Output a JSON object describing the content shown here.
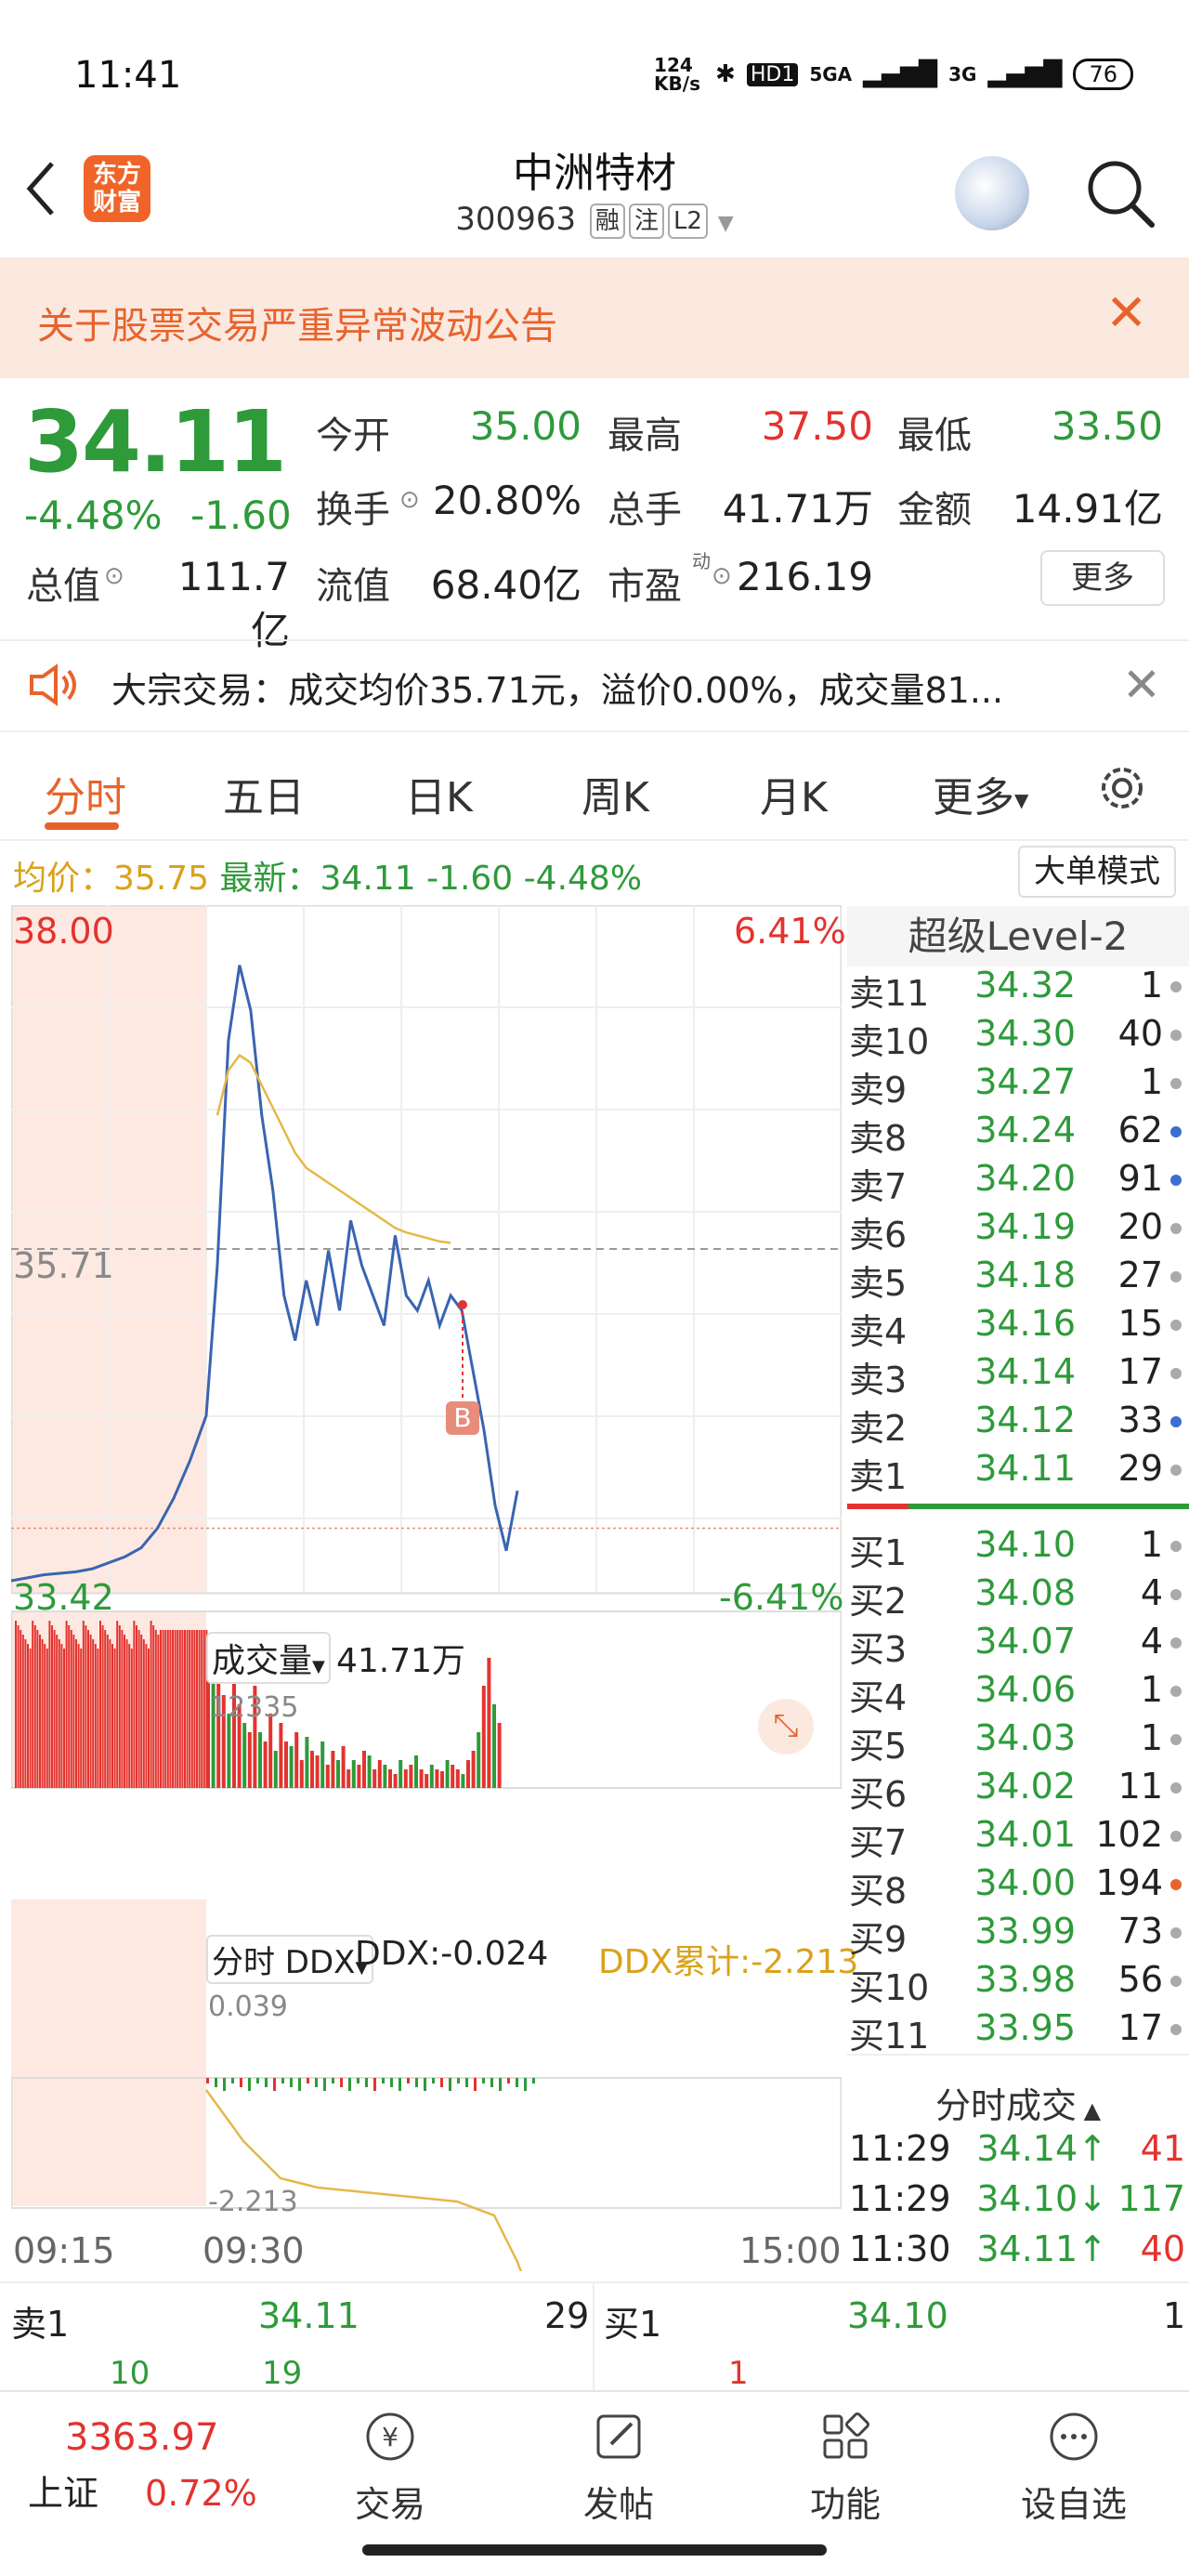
{
  "status": {
    "time": "11:41",
    "net_speed": "124 KB/s",
    "hd": "HD1",
    "sig1": "5GA",
    "sig2": "3G",
    "battery": "76"
  },
  "header": {
    "logo_text": "东方\n财富",
    "name": "中洲特材",
    "code": "300963",
    "tags": [
      "融",
      "注",
      "L2"
    ]
  },
  "notice": {
    "text": "关于股票交易严重异常波动公告"
  },
  "quote": {
    "price": "34.11",
    "change_pct": "-4.48%",
    "change_amt": "-1.60",
    "open_label": "今开",
    "open": "35.00",
    "high_label": "最高",
    "high": "37.50",
    "low_label": "最低",
    "low": "33.50",
    "turnover_label": "换手",
    "turnover": "20.80%",
    "volume_label": "总手",
    "volume": "41.71万",
    "amount_label": "金额",
    "amount": "14.91亿",
    "mcap_label": "总值",
    "mcap": "111.7亿",
    "float_label": "流值",
    "float": "68.40亿",
    "pe_label": "市盈",
    "pe_sup": "动",
    "pe": "216.19",
    "more": "更多"
  },
  "block_trade": {
    "text": "大宗交易：成交均价35.71元，溢价0.00%，成交量81..."
  },
  "tabs": [
    "分时",
    "五日",
    "日K",
    "周K",
    "月K",
    "更多"
  ],
  "avg_row": {
    "avg_label": "均价：",
    "avg": "35.75",
    "latest_label": "最新：",
    "latest": "34.11",
    "chg": "-1.60",
    "pct": "-4.48%"
  },
  "mode_button": "大单模式",
  "chart_data": {
    "type": "line",
    "title": "",
    "y_top": "38.00",
    "y_bottom": "33.42",
    "pct_top": "6.41%",
    "pct_bottom": "-6.41%",
    "ref_line": "35.71",
    "ylim": [
      33.42,
      38.0
    ],
    "x_ticks": [
      "09:15",
      "09:30",
      "15:00"
    ],
    "price_series": [
      33.5,
      33.52,
      33.54,
      33.55,
      33.56,
      33.58,
      33.62,
      33.66,
      33.72,
      33.85,
      34.05,
      34.3,
      34.6,
      35.6,
      37.1,
      37.6,
      37.3,
      36.6,
      36.1,
      35.4,
      35.1,
      35.5,
      35.2,
      35.7,
      35.3,
      35.9,
      35.6,
      35.4,
      35.2,
      35.8,
      35.4,
      35.3,
      35.5,
      35.2,
      35.4,
      35.3,
      34.9,
      34.5,
      34.0,
      33.7,
      34.1
    ],
    "avg_series": [
      null,
      null,
      null,
      null,
      null,
      null,
      null,
      null,
      null,
      null,
      null,
      null,
      null,
      36.6,
      36.9,
      37.0,
      36.95,
      36.8,
      36.65,
      36.5,
      36.35,
      36.25,
      36.2,
      36.15,
      36.1,
      36.05,
      36.0,
      35.95,
      35.9,
      35.85,
      35.82,
      35.8,
      35.78,
      35.76,
      35.75
    ],
    "volume": {
      "label": "成交量",
      "total": "41.71万",
      "max_label": "12335"
    },
    "ddx": {
      "label": "分时 DDX",
      "value_label": "DDX:",
      "value": "-0.024",
      "cum_label": "DDX累计:",
      "cum": "-2.213",
      "top": "0.039",
      "bottom": "-2.213"
    },
    "marker": "B"
  },
  "orderbook": {
    "title": "超级Level-2",
    "asks": [
      {
        "label": "卖11",
        "price": "34.32",
        "vol": "1",
        "dot": "#aaaaaa"
      },
      {
        "label": "卖10",
        "price": "34.30",
        "vol": "40",
        "dot": "#aaaaaa"
      },
      {
        "label": "卖9",
        "price": "34.27",
        "vol": "1",
        "dot": "#aaaaaa"
      },
      {
        "label": "卖8",
        "price": "34.24",
        "vol": "62",
        "dot": "#3a6fd0"
      },
      {
        "label": "卖7",
        "price": "34.20",
        "vol": "91",
        "dot": "#3a6fd0"
      },
      {
        "label": "卖6",
        "price": "34.19",
        "vol": "20",
        "dot": "#aaaaaa"
      },
      {
        "label": "卖5",
        "price": "34.18",
        "vol": "27",
        "dot": "#aaaaaa"
      },
      {
        "label": "卖4",
        "price": "34.16",
        "vol": "15",
        "dot": "#aaaaaa"
      },
      {
        "label": "卖3",
        "price": "34.14",
        "vol": "17",
        "dot": "#aaaaaa"
      },
      {
        "label": "卖2",
        "price": "34.12",
        "vol": "33",
        "dot": "#3a6fd0"
      },
      {
        "label": "卖1",
        "price": "34.11",
        "vol": "29",
        "dot": "#aaaaaa"
      }
    ],
    "bids": [
      {
        "label": "买1",
        "price": "34.10",
        "vol": "1",
        "dot": "#aaaaaa"
      },
      {
        "label": "买2",
        "price": "34.08",
        "vol": "4",
        "dot": "#aaaaaa"
      },
      {
        "label": "买3",
        "price": "34.07",
        "vol": "4",
        "dot": "#aaaaaa"
      },
      {
        "label": "买4",
        "price": "34.06",
        "vol": "1",
        "dot": "#aaaaaa"
      },
      {
        "label": "买5",
        "price": "34.03",
        "vol": "1",
        "dot": "#aaaaaa"
      },
      {
        "label": "买6",
        "price": "34.02",
        "vol": "11",
        "dot": "#aaaaaa"
      },
      {
        "label": "买7",
        "price": "34.01",
        "vol": "102",
        "dot": "#aaaaaa"
      },
      {
        "label": "买8",
        "price": "34.00",
        "vol": "194",
        "dot": "#e8632c"
      },
      {
        "label": "买9",
        "price": "33.99",
        "vol": "73",
        "dot": "#aaaaaa"
      },
      {
        "label": "买10",
        "price": "33.98",
        "vol": "56",
        "dot": "#aaaaaa"
      },
      {
        "label": "买11",
        "price": "33.95",
        "vol": "17",
        "dot": "#aaaaaa"
      }
    ],
    "ticks_title": "分时成交",
    "ticks": [
      {
        "time": "11:29",
        "price": "34.14",
        "dir": "↑",
        "vol": "41",
        "color": "#2e9a3a",
        "vcolor": "#e3332f"
      },
      {
        "time": "11:29",
        "price": "34.10",
        "dir": "↓",
        "vol": "117",
        "color": "#2e9a3a",
        "vcolor": "#2e9a3a"
      },
      {
        "time": "11:30",
        "price": "34.11",
        "dir": "↑",
        "vol": "40",
        "color": "#2e9a3a",
        "vcolor": "#e3332f"
      }
    ]
  },
  "strip": {
    "ask_label": "卖1",
    "ask_price": "34.11",
    "ask_vol": "29",
    "bid_label": "买1",
    "bid_price": "34.10",
    "bid_vol": "1",
    "sub1": "10",
    "sub2": "19",
    "sub3": "1"
  },
  "bottom_nav": {
    "index_value": "3363.97",
    "index_name": "上证",
    "index_pct": "0.72%",
    "items": [
      "交易",
      "发帖",
      "功能",
      "设自选"
    ]
  }
}
